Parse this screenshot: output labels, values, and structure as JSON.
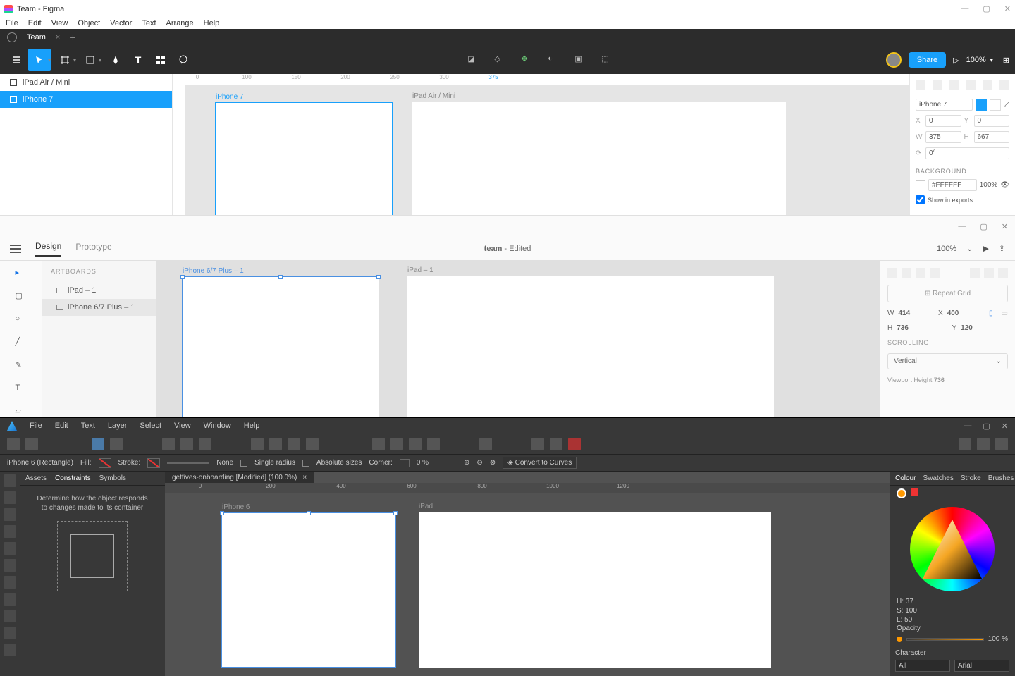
{
  "figma": {
    "window_title": "Team - Figma",
    "menu": [
      "File",
      "Edit",
      "View",
      "Object",
      "Vector",
      "Text",
      "Arrange",
      "Help"
    ],
    "tab_name": "Team",
    "share_label": "Share",
    "zoom": "100%",
    "layers": [
      {
        "name": "iPad Air / Mini",
        "selected": false
      },
      {
        "name": "iPhone 7",
        "selected": true
      }
    ],
    "ruler_marks": [
      "0",
      "100",
      "150",
      "200",
      "250",
      "300",
      "375"
    ],
    "frames": [
      {
        "label": "iPhone 7"
      },
      {
        "label": "iPad Air / Mini"
      }
    ],
    "props": {
      "device": "iPhone 7",
      "x": "0",
      "y": "0",
      "w": "375",
      "h": "667",
      "rotation": "0°",
      "section": "BACKGROUND",
      "fill": "#FFFFFF",
      "opacity": "100%",
      "show_exports": "Show in exports"
    }
  },
  "xd": {
    "tabs": [
      "Design",
      "Prototype"
    ],
    "doc_title": "team",
    "doc_status": "Edited",
    "zoom": "100%",
    "artboards_label": "ARTBOARDS",
    "layers": [
      {
        "name": "iPad – 1",
        "selected": false
      },
      {
        "name": "iPhone 6/7 Plus – 1",
        "selected": true
      }
    ],
    "frames": [
      {
        "label": "iPhone 6/7 Plus – 1"
      },
      {
        "label": "iPad – 1"
      }
    ],
    "props": {
      "repeat_label": "Repeat Grid",
      "w": "414",
      "x": "400",
      "h": "736",
      "y": "120",
      "scrolling_label": "SCROLLING",
      "scrolling_value": "Vertical",
      "viewport_label": "Viewport Height",
      "viewport_value": "736"
    }
  },
  "affinity": {
    "menu": [
      "File",
      "Edit",
      "Text",
      "Layer",
      "Select",
      "View",
      "Window",
      "Help"
    ],
    "context": {
      "selection": "iPhone 6 (Rectangle)",
      "fill_label": "Fill:",
      "stroke_label": "Stroke:",
      "stroke_val": "None",
      "single_radius": "Single radius",
      "absolute_sizes": "Absolute sizes",
      "corner_label": "Corner:",
      "corner_value": "0 %",
      "convert": "Convert to Curves"
    },
    "doc_tab": "getfives-onboarding [Modified] (100.0%)",
    "left_tabs": [
      "Assets",
      "Constraints",
      "Symbols"
    ],
    "hint": "Determine how the object responds to changes made to its container",
    "ruler_marks": [
      "0",
      "200",
      "400",
      "600",
      "800",
      "1000",
      "1200"
    ],
    "frames": [
      {
        "label": "iPhone 6"
      },
      {
        "label": "iPad"
      }
    ],
    "right_tabs": [
      "Colour",
      "Swatches",
      "Stroke",
      "Brushes"
    ],
    "hsl": {
      "h": "H: 37",
      "s": "S: 100",
      "l": "L: 50"
    },
    "opacity_label": "Opacity",
    "opacity_val": "100 %",
    "character_label": "Character",
    "font_coll": "All",
    "font_name": "Arial"
  }
}
